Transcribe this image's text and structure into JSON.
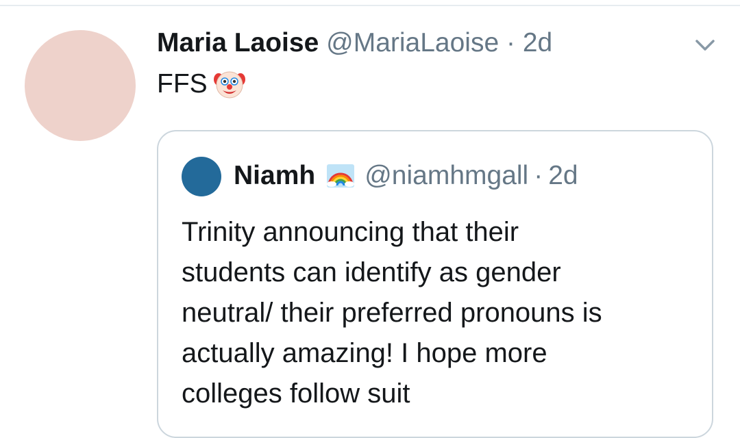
{
  "tweet": {
    "display_name": "Maria Laoise",
    "handle": "@MariaLaoise",
    "separator": "·",
    "time": "2d",
    "text": "FFS",
    "emoji_icon": "clown-face-icon"
  },
  "quote": {
    "display_name": "Niamh",
    "name_emoji_icon": "rainbow-icon",
    "handle": "@niamhmgall",
    "separator": "·",
    "time": "2d",
    "text_lines": [
      "Trinity announcing that their",
      "students can identify as gender",
      "neutral/ their preferred pronouns is",
      "actually amazing! I hope more",
      "colleges follow suit"
    ]
  },
  "colors": {
    "avatar_main": "#eed2cb",
    "avatar_quote": "#236a9a",
    "secondary_text": "#657786",
    "border": "#ccd6dd"
  }
}
